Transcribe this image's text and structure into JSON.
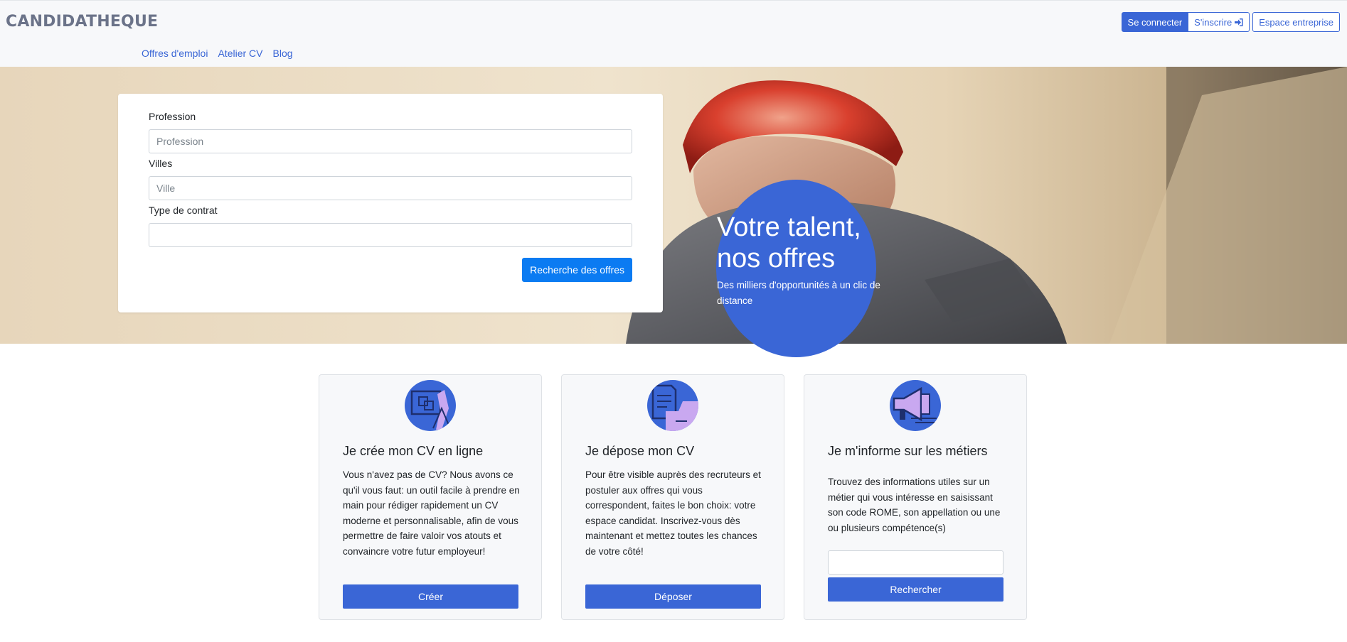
{
  "header": {
    "logo": "CANDIDATHEQUE",
    "nav": [
      "Offres d'emploi",
      "Atelier CV",
      "Blog"
    ],
    "login": "Se connecter",
    "signup": "S'inscrire",
    "enterprise": "Espace entreprise"
  },
  "search": {
    "profession_label": "Profession",
    "profession_placeholder": "Profession",
    "city_label": "Villes",
    "city_placeholder": "Ville",
    "contract_label": "Type de contrat",
    "contract_value": "",
    "submit": "Recherche des offres"
  },
  "hero": {
    "title": "Votre talent, nos offres",
    "subtitle": "Des milliers d'opportunités à un clic de distance"
  },
  "cards": [
    {
      "icon": "cv-builder-icon",
      "title": "Je crée mon CV en ligne",
      "text": "Vous n'avez pas de CV? Nous avons ce qu'il vous faut: un outil facile à prendre en main pour rédiger rapidement un CV moderne et personnalisable, afin de vous permettre de faire valoir vos atouts et convaincre votre futur employeur!",
      "button": "Créer"
    },
    {
      "icon": "document-upload-icon",
      "title": "Je dépose mon CV",
      "text": "Pour être visible auprès des recruteurs et postuler aux offres qui vous correspondent, faites le bon choix: votre espace candidat. Inscrivez-vous dès maintenant et mettez toutes les chances de votre côté!",
      "button": "Déposer"
    },
    {
      "icon": "megaphone-icon",
      "title": "Je m'informe sur les métiers",
      "text": "Trouvez des informations utiles sur un métier qui vous intéresse en saisissant son code ROME, son appellation ou une ou plusieurs compétence(s)",
      "input_value": "",
      "button": "Rechercher"
    }
  ],
  "colors": {
    "brand": "#3a66d6",
    "search_button": "#0b7bf2",
    "logo": "#6b7389"
  }
}
